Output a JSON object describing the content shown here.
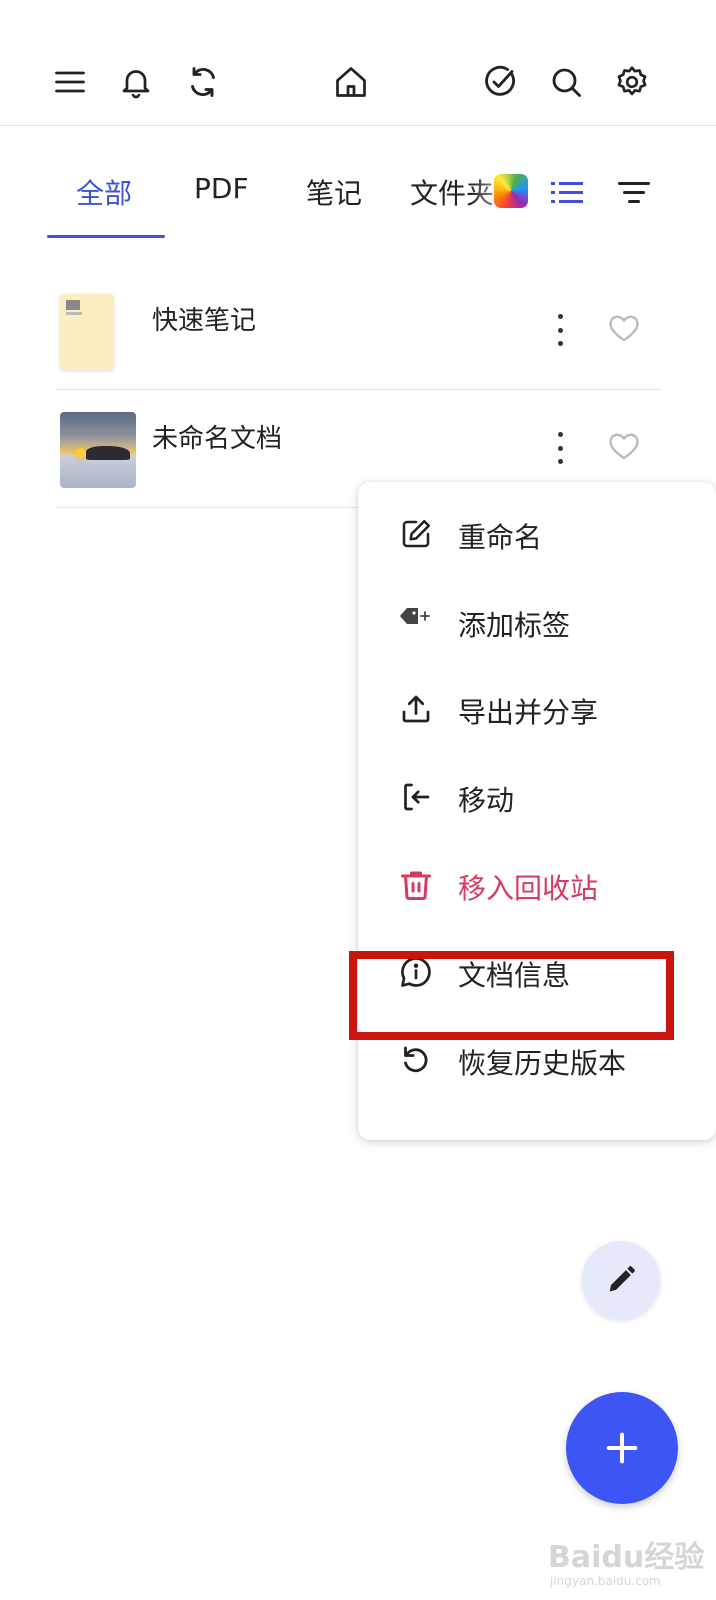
{
  "tabs": [
    {
      "label": "全部",
      "active": true
    },
    {
      "label": "PDF",
      "active": false
    },
    {
      "label": "笔记",
      "active": false
    },
    {
      "label": "文件夹",
      "active": false
    }
  ],
  "files": [
    {
      "name": "快速笔记",
      "thumbnail": "note"
    },
    {
      "name": "未命名文档",
      "thumbnail": "photo"
    }
  ],
  "context_menu": {
    "items": [
      {
        "label": "重命名",
        "icon": "edit-icon"
      },
      {
        "label": "添加标签",
        "icon": "tag-add-icon"
      },
      {
        "label": "导出并分享",
        "icon": "share-icon"
      },
      {
        "label": "移动",
        "icon": "move-icon"
      },
      {
        "label": "移入回收站",
        "icon": "trash-icon",
        "style": "danger"
      },
      {
        "label": "文档信息",
        "icon": "info-icon",
        "highlighted": true
      },
      {
        "label": "恢复历史版本",
        "icon": "restore-icon"
      }
    ]
  },
  "colors": {
    "accent": "#3f51d6",
    "danger": "#d93a5f",
    "fab": "#3d55f4",
    "highlight": "#c8160e"
  },
  "watermark": {
    "logo": "Baidu经验",
    "sub": "jingyan.baidu.com"
  }
}
